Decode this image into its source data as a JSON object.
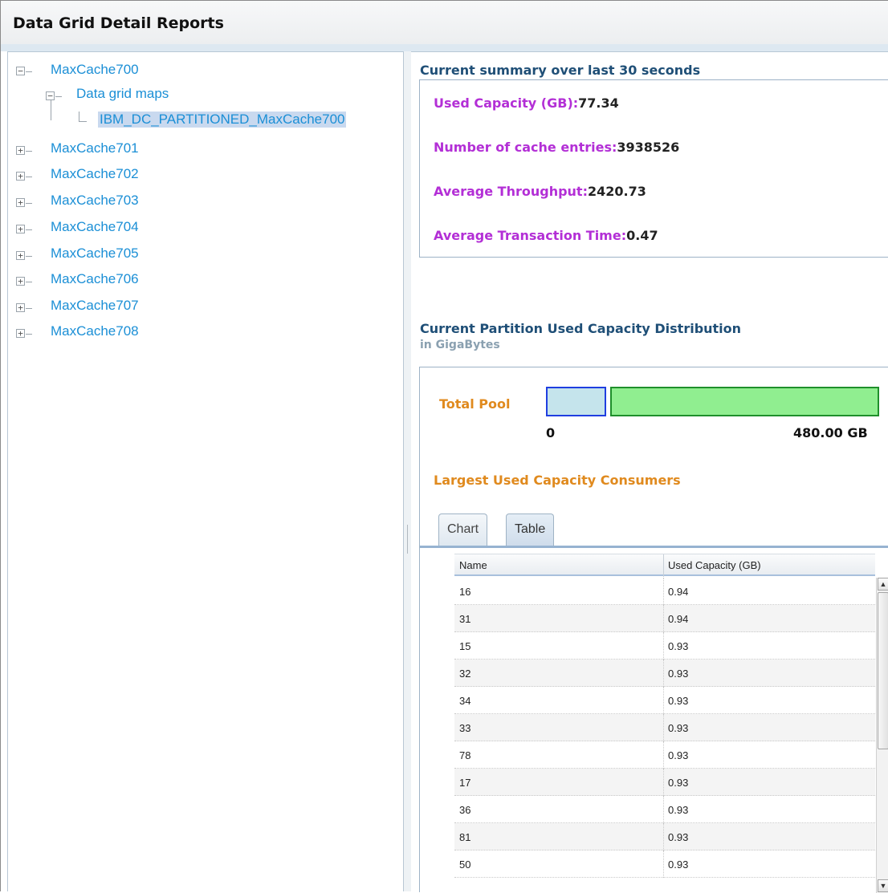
{
  "header": {
    "title": "Data Grid Detail Reports"
  },
  "tree": {
    "root_selected": "MaxCache700",
    "child": "Data grid maps",
    "leaf": "IBM_DC_PARTITIONED_MaxCache700",
    "nodes": [
      "MaxCache701",
      "MaxCache702",
      "MaxCache703",
      "MaxCache704",
      "MaxCache705",
      "MaxCache706",
      "MaxCache707",
      "MaxCache708"
    ]
  },
  "summary": {
    "title": "Current summary over last 30 seconds",
    "used_capacity_label": "Used Capacity (GB):",
    "used_capacity_value": "77.34",
    "entries_label": "Number of cache entries:",
    "entries_value": "3938526",
    "throughput_label": "Average Throughput:",
    "throughput_value": "2420.73",
    "txn_time_label": "Average Transaction Time:",
    "txn_time_value": "0.47"
  },
  "distribution": {
    "title": "Current Partition Used Capacity Distribution",
    "subtitle": "in GigaBytes",
    "pool_label": "Total Pool",
    "axis_min": "0",
    "axis_max": "480.00 GB",
    "used_fraction": 0.161,
    "consumers_title": "Largest Used Capacity Consumers",
    "colors": {
      "used": "#c5e4ec",
      "free": "#90ee90"
    }
  },
  "tabs": [
    "Chart",
    "Table"
  ],
  "active_tab": "Table",
  "table": {
    "columns": [
      "Name",
      "Used Capacity (GB)"
    ],
    "rows": [
      [
        "16",
        "0.94"
      ],
      [
        "31",
        "0.94"
      ],
      [
        "15",
        "0.93"
      ],
      [
        "32",
        "0.93"
      ],
      [
        "34",
        "0.93"
      ],
      [
        "33",
        "0.93"
      ],
      [
        "78",
        "0.93"
      ],
      [
        "17",
        "0.93"
      ],
      [
        "36",
        "0.93"
      ],
      [
        "81",
        "0.93"
      ],
      [
        "50",
        "0.93"
      ]
    ]
  }
}
